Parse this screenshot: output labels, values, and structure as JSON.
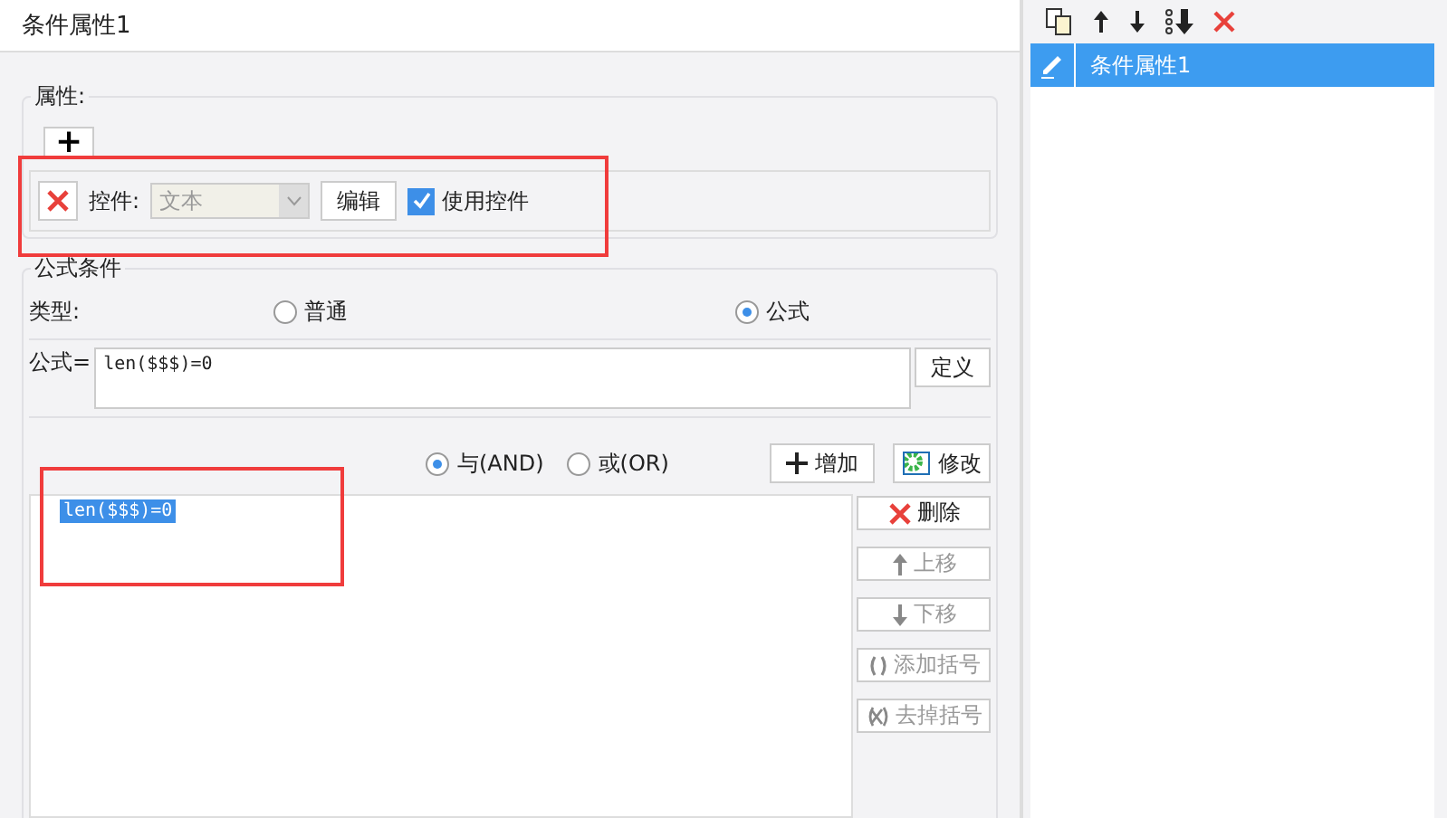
{
  "title": "条件属性1",
  "attributes": {
    "legend": "属性:",
    "add_button": "+",
    "control_label": "控件:",
    "control_select": {
      "value": "文本",
      "disabled": true
    },
    "edit_button": "编辑",
    "use_control": {
      "label": "使用控件",
      "checked": true
    }
  },
  "formula_condition": {
    "legend": "公式条件",
    "type_label": "类型:",
    "types": [
      {
        "label": "普通",
        "selected": false
      },
      {
        "label": "公式",
        "selected": true
      }
    ],
    "formula_label": "公式=",
    "formula_value": "len($$$)=0",
    "define_button": "定义",
    "logic": [
      {
        "label": "与(AND)",
        "selected": true
      },
      {
        "label": "或(OR)",
        "selected": false
      }
    ],
    "add_button": "增加",
    "modify_button": "修改",
    "conditions": [
      {
        "text": "len($$$)=0",
        "selected": true
      }
    ],
    "side_buttons": [
      {
        "label": "删除",
        "kind": "delete",
        "disabled": false
      },
      {
        "label": "上移",
        "kind": "up",
        "disabled": true
      },
      {
        "label": "下移",
        "kind": "down",
        "disabled": true
      },
      {
        "label": "添加括号",
        "kind": "paren",
        "disabled": true
      },
      {
        "label": "去掉括号",
        "kind": "unparen",
        "disabled": true
      }
    ]
  },
  "side_list": {
    "items": [
      {
        "label": "条件属性1",
        "selected": true
      }
    ]
  }
}
